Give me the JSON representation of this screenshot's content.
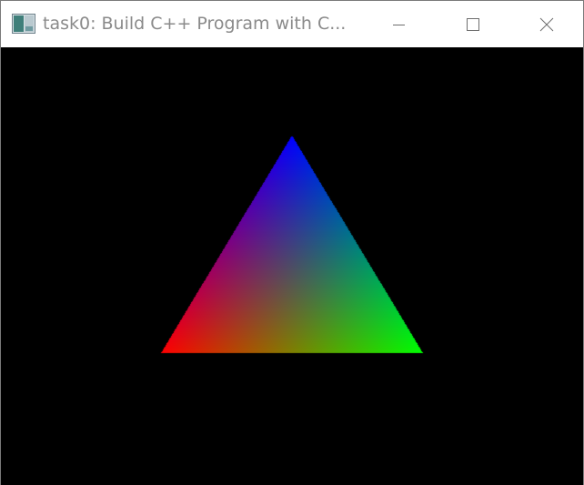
{
  "window": {
    "title": "task0: Build C++ Program with C..."
  },
  "icons": {
    "app": "app-window-icon",
    "minimize": "minimize-icon",
    "maximize": "maximize-icon",
    "close": "close-icon"
  },
  "scene": {
    "background": "#000000",
    "triangle_vertex_colors": [
      "#0000ff",
      "#ff0000",
      "#00ff00"
    ]
  }
}
